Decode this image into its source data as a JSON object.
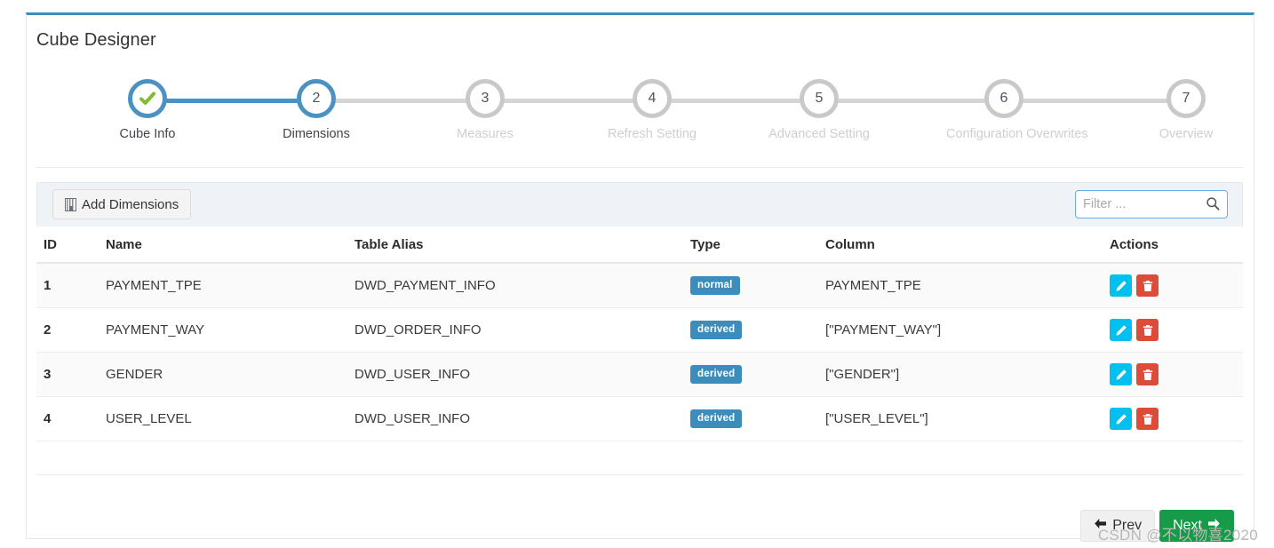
{
  "panel": {
    "title": "Cube Designer",
    "accent_color": "#3c8dbc"
  },
  "wizard": {
    "steps": [
      {
        "number": "1",
        "label": "Cube Info",
        "state": "complete",
        "icon": "check-icon"
      },
      {
        "number": "2",
        "label": "Dimensions",
        "state": "active",
        "icon": ""
      },
      {
        "number": "3",
        "label": "Measures",
        "state": "pending",
        "icon": ""
      },
      {
        "number": "4",
        "label": "Refresh Setting",
        "state": "pending",
        "icon": ""
      },
      {
        "number": "5",
        "label": "Advanced Setting",
        "state": "pending",
        "icon": ""
      },
      {
        "number": "6",
        "label": "Configuration Overwrites",
        "state": "pending",
        "icon": ""
      },
      {
        "number": "7",
        "label": "Overview",
        "state": "pending",
        "icon": ""
      }
    ]
  },
  "toolbar": {
    "add_label": "Add Dimensions",
    "filter_placeholder": "Filter ...",
    "filter_value": ""
  },
  "table": {
    "headers": [
      "ID",
      "Name",
      "Table Alias",
      "Type",
      "Column",
      "Actions"
    ],
    "rows": [
      {
        "id": "1",
        "name": "PAYMENT_TPE",
        "alias": "DWD_PAYMENT_INFO",
        "type": "normal",
        "column": "PAYMENT_TPE"
      },
      {
        "id": "2",
        "name": "PAYMENT_WAY",
        "alias": "DWD_ORDER_INFO",
        "type": "derived",
        "column": "[\"PAYMENT_WAY\"]"
      },
      {
        "id": "3",
        "name": "GENDER",
        "alias": "DWD_USER_INFO",
        "type": "derived",
        "column": "[\"GENDER\"]"
      },
      {
        "id": "4",
        "name": "USER_LEVEL",
        "alias": "DWD_USER_INFO",
        "type": "derived",
        "column": "[\"USER_LEVEL\"]"
      }
    ],
    "badge_color": "#3c8dbc",
    "edit_color": "#00c0ef",
    "delete_color": "#dd4b39"
  },
  "footer": {
    "prev_label": "Prev",
    "next_label": "Next",
    "next_color": "#169b48"
  },
  "watermark": {
    "text": "CSDN @不以物喜2020"
  }
}
